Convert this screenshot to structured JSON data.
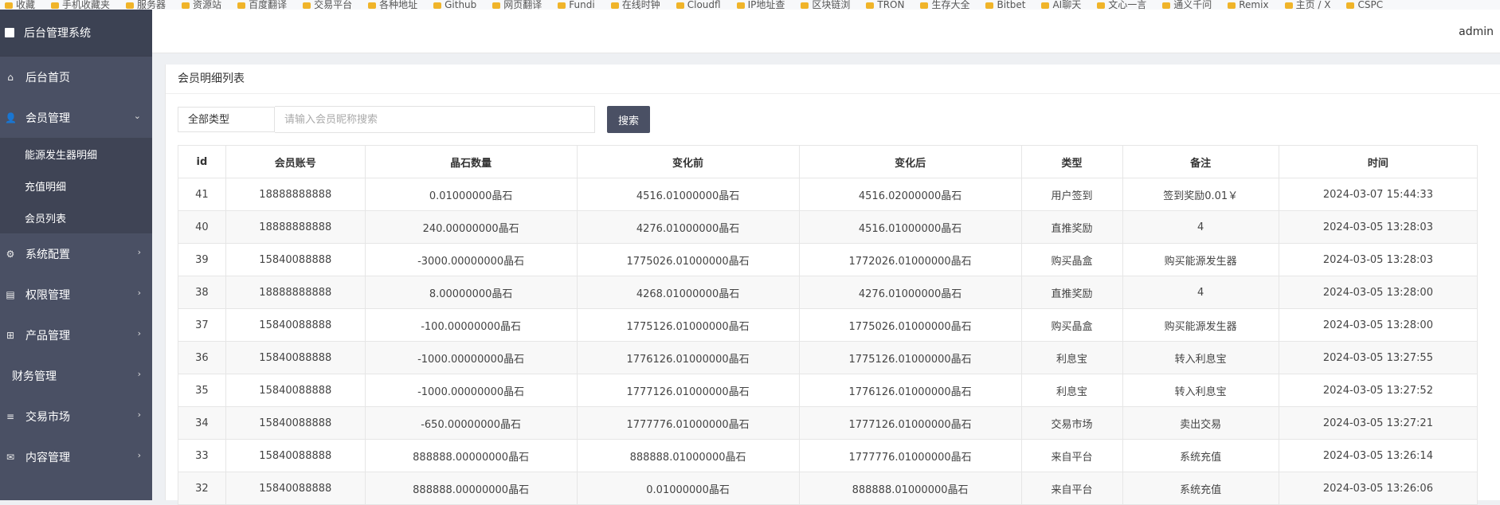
{
  "bookmarks": [
    "收藏",
    "手机收藏夹",
    "服务器",
    "资源站",
    "百度翻译",
    "交易平台",
    "各种地址",
    "Github",
    "网页翻译",
    "Fundi",
    "在线时钟",
    "Cloudfl",
    "IP地址查",
    "区块链浏",
    "TRON",
    "生存大全",
    "Bitbet",
    "AI聊天",
    "文心一言",
    "通义千问",
    "Remix",
    "主页 / X",
    "CSPC"
  ],
  "sidebar": {
    "brand": "后台管理系统",
    "home": "后台首页",
    "member": {
      "label": "会员管理",
      "items": [
        "能源发生器明细",
        "充值明细",
        "会员列表"
      ]
    },
    "menus": [
      {
        "label": "系统配置",
        "icon": "gears-icon",
        "glyph": "⚙"
      },
      {
        "label": "权限管理",
        "icon": "id-card-icon",
        "glyph": "▤"
      },
      {
        "label": "产品管理",
        "icon": "windows-icon",
        "glyph": "⊞"
      },
      {
        "label": "财务管理",
        "icon": "",
        "glyph": ""
      },
      {
        "label": "交易市场",
        "icon": "bars-icon",
        "glyph": "≡"
      },
      {
        "label": "内容管理",
        "icon": "envelope-icon",
        "glyph": "✉"
      }
    ]
  },
  "header": {
    "user": "admin"
  },
  "panel": {
    "title": "会员明细列表"
  },
  "search": {
    "type_value": "全部类型",
    "placeholder": "请输入会员昵称搜索",
    "button": "搜索"
  },
  "table": {
    "columns": [
      "id",
      "会员账号",
      "晶石数量",
      "变化前",
      "变化后",
      "类型",
      "备注",
      "时间"
    ],
    "rows": [
      [
        "41",
        "18888888888",
        "0.01000000晶石",
        "4516.01000000晶石",
        "4516.02000000晶石",
        "用户签到",
        "签到奖励0.01￥",
        "2024-03-07 15:44:33"
      ],
      [
        "40",
        "18888888888",
        "240.00000000晶石",
        "4276.01000000晶石",
        "4516.01000000晶石",
        "直推奖励",
        "4",
        "2024-03-05 13:28:03"
      ],
      [
        "39",
        "15840088888",
        "-3000.00000000晶石",
        "1775026.01000000晶石",
        "1772026.01000000晶石",
        "购买晶盒",
        "购买能源发生器",
        "2024-03-05 13:28:03"
      ],
      [
        "38",
        "18888888888",
        "8.00000000晶石",
        "4268.01000000晶石",
        "4276.01000000晶石",
        "直推奖励",
        "4",
        "2024-03-05 13:28:00"
      ],
      [
        "37",
        "15840088888",
        "-100.00000000晶石",
        "1775126.01000000晶石",
        "1775026.01000000晶石",
        "购买晶盒",
        "购买能源发生器",
        "2024-03-05 13:28:00"
      ],
      [
        "36",
        "15840088888",
        "-1000.00000000晶石",
        "1776126.01000000晶石",
        "1775126.01000000晶石",
        "利息宝",
        "转入利息宝",
        "2024-03-05 13:27:55"
      ],
      [
        "35",
        "15840088888",
        "-1000.00000000晶石",
        "1777126.01000000晶石",
        "1776126.01000000晶石",
        "利息宝",
        "转入利息宝",
        "2024-03-05 13:27:52"
      ],
      [
        "34",
        "15840088888",
        "-650.00000000晶石",
        "1777776.01000000晶石",
        "1777126.01000000晶石",
        "交易市场",
        "卖出交易",
        "2024-03-05 13:27:21"
      ],
      [
        "33",
        "15840088888",
        "888888.00000000晶石",
        "888888.01000000晶石",
        "1777776.01000000晶石",
        "来自平台",
        "系统充值",
        "2024-03-05 13:26:14"
      ],
      [
        "32",
        "15840088888",
        "888888.00000000晶石",
        "0.01000000晶石",
        "888888.01000000晶石",
        "来自平台",
        "系统充值",
        "2024-03-05 13:26:06"
      ]
    ]
  }
}
